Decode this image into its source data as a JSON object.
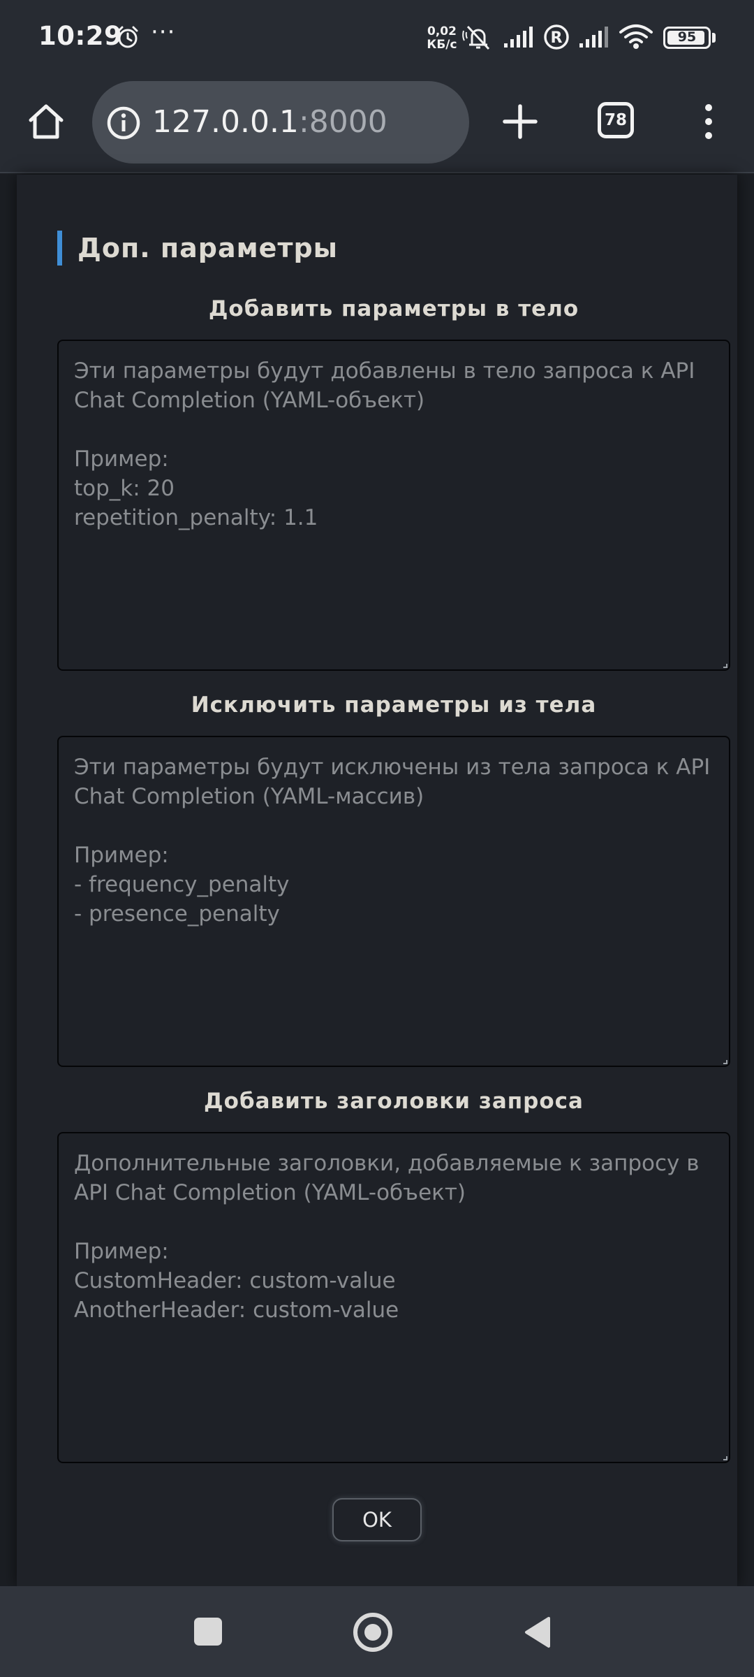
{
  "status_bar": {
    "time": "10:29",
    "dots": "···",
    "speed_value": "0,02",
    "speed_unit": "КБ/с",
    "battery": "95",
    "battery_level_percent": 95
  },
  "browser": {
    "url_host": "127.0.0.1",
    "url_port": ":8000",
    "tab_count": "78"
  },
  "page": {
    "section_title": "Доп. параметры",
    "fields": [
      {
        "label": "Добавить параметры в тело",
        "placeholder": "Эти параметры будут добавлены в тело запроса к API Chat Completion (YAML-объект)\n\nПример:\ntop_k: 20\nrepetition_penalty: 1.1"
      },
      {
        "label": "Исключить параметры из тела",
        "placeholder": "Эти параметры будут исключены из тела запроса к API Chat Completion (YAML-массив)\n\nПример:\n- frequency_penalty\n- presence_penalty"
      },
      {
        "label": "Добавить заголовки запроса",
        "placeholder": "Дополнительные заголовки, добавляемые к запросу в API Chat Completion (YAML-объект)\n\nПример:\nCustomHeader: custom-value\nAnotherHeader: custom-value"
      }
    ],
    "ok_label": "OK"
  },
  "colors": {
    "accent": "#3f8ed6",
    "background": "#1f2228",
    "text": "#dddad2",
    "placeholder": "#8a8d91"
  },
  "icons": {
    "status": [
      "alarm-icon",
      "mute-icon",
      "signal-icon",
      "roaming-icon",
      "wifi-icon",
      "battery-icon"
    ],
    "toolbar": [
      "home-icon",
      "info-icon",
      "plus-icon",
      "tabs-icon",
      "more-vert-icon"
    ],
    "nav": [
      "recents-icon",
      "home-circle-icon",
      "back-icon"
    ]
  }
}
